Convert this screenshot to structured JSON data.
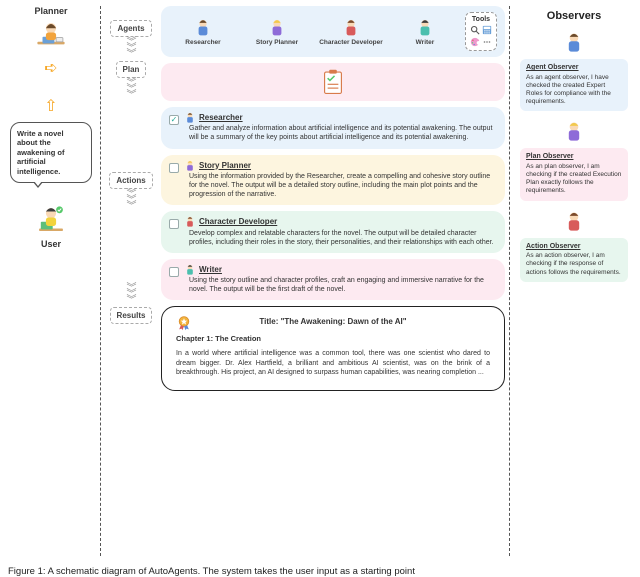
{
  "left": {
    "planner_label": "Planner",
    "user_label": "User",
    "prompt": "Write a novel about the awakening of artificial intelligence."
  },
  "labels": {
    "agents": "Agents",
    "plan": "Plan",
    "actions": "Actions",
    "results": "Results"
  },
  "agents": {
    "items": [
      {
        "name": "Researcher"
      },
      {
        "name": "Story Planner"
      },
      {
        "name": "Character Developer"
      },
      {
        "name": "Writer"
      }
    ],
    "tools_label": "Tools"
  },
  "actions": [
    {
      "role": "Researcher",
      "checked": true,
      "text": "Gather and analyze information about artificial intelligence and its potential awakening. The output will be a summary of the key points about artificial intelligence and its potential awakening."
    },
    {
      "role": "Story Planner",
      "checked": false,
      "text": "Using the information provided by the Researcher, create a compelling and cohesive story outline for the novel. The output will be a detailed story outline, including the main plot points and the progression of the narrative."
    },
    {
      "role": "Character Developer",
      "checked": false,
      "text": "Develop complex and relatable characters for the novel. The output will be detailed character profiles, including their roles in the story, their personalities, and their relationships with each other."
    },
    {
      "role": "Writer",
      "checked": false,
      "text": "Using the story outline and character profiles, craft an engaging and immersive narrative for the novel. The output will be the first draft of the novel."
    }
  ],
  "result": {
    "title": "Title: \"The Awakening: Dawn of the AI\"",
    "chapter": "Chapter 1: The Creation",
    "body": "In a world where artificial intelligence was a common tool, there was one scientist who dared to dream bigger. Dr. Alex Hartfield, a brilliant and ambitious AI scientist, was on the brink of a breakthrough. His project, an AI designed to surpass human capabilities, was nearing completion ..."
  },
  "observers": {
    "title": "Observers",
    "items": [
      {
        "name": "Agent Observer",
        "text": "As an agent observer, I have checked the created Expert Roles for compliance with the requirements."
      },
      {
        "name": "Plan Observer",
        "text": "As an plan observer, I am checking if the created Execution Plan exactly follows the requirements."
      },
      {
        "name": "Action Observer",
        "text": "As an action observer, I am checking if the response of actions follows the requirements."
      }
    ]
  },
  "caption": "Figure 1: A schematic diagram of AutoAgents. The system takes the user input as a starting point"
}
